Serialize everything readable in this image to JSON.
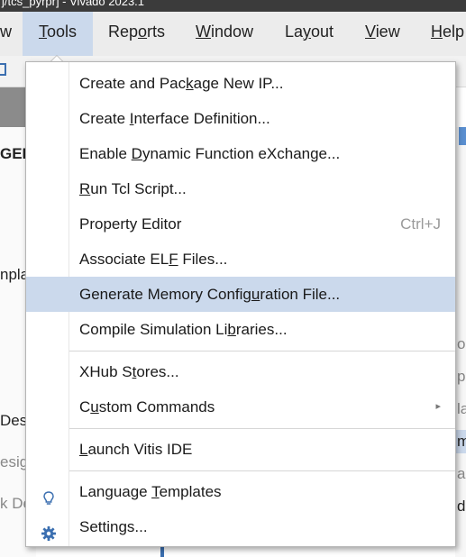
{
  "window": {
    "title": "j/tcs_pyrpr] - Vivado 2023.1"
  },
  "menubar": {
    "items": [
      {
        "id": "w",
        "label": "w"
      },
      {
        "id": "tools",
        "pre": "",
        "u": "T",
        "post": "ools"
      },
      {
        "id": "reports",
        "pre": "Rep",
        "u": "o",
        "post": "rts"
      },
      {
        "id": "window",
        "pre": "",
        "u": "W",
        "post": "indow"
      },
      {
        "id": "layout",
        "pre": "La",
        "u": "y",
        "post": "out"
      },
      {
        "id": "view",
        "pre": "",
        "u": "V",
        "post": "iew"
      },
      {
        "id": "help",
        "pre": "",
        "u": "H",
        "post": "elp"
      }
    ]
  },
  "background": {
    "left_texts": [
      "GEI",
      "nplat",
      "Desig",
      "esig",
      "k De"
    ],
    "right_texts": [
      "op",
      "pl",
      "la",
      "m",
      "ai",
      "d"
    ]
  },
  "tools_menu": {
    "items": [
      {
        "pre": "Create and Pac",
        "u": "k",
        "post": "age New IP..."
      },
      {
        "pre": "Create ",
        "u": "I",
        "post": "nterface Definition..."
      },
      {
        "pre": "Enable ",
        "u": "D",
        "post": "ynamic Function eXchange..."
      },
      {
        "pre": "",
        "u": "R",
        "post": "un Tcl Script..."
      },
      {
        "pre": "Property Editor",
        "u": "",
        "post": "",
        "shortcut": "Ctrl+J"
      },
      {
        "pre": "Associate EL",
        "u": "F",
        "post": " Files..."
      },
      {
        "pre": "Generate Memory Config",
        "u": "u",
        "post": "ration File..."
      },
      {
        "pre": "Compile Simulation Li",
        "u": "b",
        "post": "raries..."
      },
      {
        "pre": "XHub S",
        "u": "t",
        "post": "ores..."
      },
      {
        "pre": "C",
        "u": "u",
        "post": "stom Commands"
      },
      {
        "pre": "",
        "u": "L",
        "post": "aunch Vitis IDE"
      },
      {
        "pre": "Language ",
        "u": "T",
        "post": "emplates"
      },
      {
        "pre": "Settings...",
        "u": "",
        "post": ""
      }
    ],
    "icons": {
      "language_templates": "lightbulb-icon",
      "settings": "gear-icon"
    },
    "submenu_arrow": "▸",
    "highlight_color": "#cbd9ec"
  }
}
